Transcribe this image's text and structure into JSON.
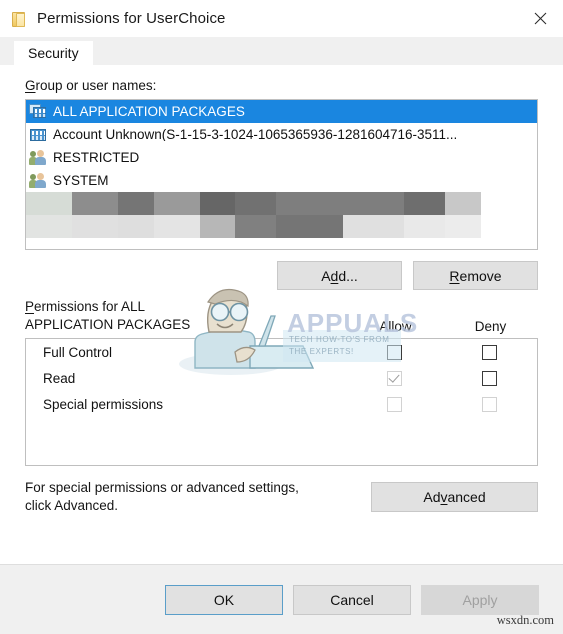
{
  "window": {
    "title": "Permissions for UserChoice",
    "icon": "folder-icon",
    "close_label": "×"
  },
  "tabs": [
    {
      "label": "Security",
      "active": true
    }
  ],
  "group_section": {
    "label": "Group or user names:",
    "label_accel": "G",
    "label_rest": "roup or user names:",
    "items": [
      {
        "name": "ALL APPLICATION PACKAGES",
        "icon": "app-package-icon",
        "selected": true
      },
      {
        "name": "Account Unknown(S-1-15-3-1024-1065365936-1281604716-3511...",
        "icon": "app-package-icon",
        "selected": false
      },
      {
        "name": "RESTRICTED",
        "icon": "user-group-icon",
        "selected": false
      },
      {
        "name": "SYSTEM",
        "icon": "user-group-icon",
        "selected": false
      }
    ],
    "censored_rows": [
      [
        "#d6dcd6",
        "#8d8d8d",
        "#757575",
        "#9a9a9a",
        "#666666",
        "#717171",
        "#7e7e7e",
        "#7e7e7e",
        "#6e6e6e",
        "#c8c8c8",
        "#ffffff"
      ],
      [
        "#e2e4e2",
        "#e0e0e0",
        "#dedede",
        "#e4e4e4",
        "#b7b7b7",
        "#808080",
        "#757575",
        "#e0e0e0",
        "#e9e9e9",
        "#ececec",
        "#ffffff"
      ]
    ]
  },
  "buttons": {
    "add": "Add...",
    "add_accel": "d",
    "remove": "Remove",
    "remove_accel": "R",
    "advanced": "Advanced",
    "advanced_accel": "v",
    "ok": "OK",
    "cancel": "Cancel",
    "apply": "Apply"
  },
  "permissions_section": {
    "label_line1": "Permissions for ALL",
    "label_line2": "APPLICATION PACKAGES",
    "label_accel": "P",
    "columns": [
      "Allow",
      "Deny"
    ],
    "rows": [
      {
        "name": "Full Control",
        "allow": "unchecked",
        "deny": "unchecked"
      },
      {
        "name": "Read",
        "allow": "checked-disabled",
        "deny": "unchecked"
      },
      {
        "name": "Special permissions",
        "allow": "unchecked-disabled",
        "deny": "unchecked-disabled"
      }
    ]
  },
  "advanced_note": {
    "line1": "For special permissions or advanced settings,",
    "line2": "click Advanced."
  },
  "watermarks": {
    "appuals": "APPUALS",
    "appuals_sub1": "TECH HOW-TO'S FROM",
    "appuals_sub2": "THE EXPERTS!",
    "site": "wsxdn.com"
  },
  "colors": {
    "selection": "#1a86e0",
    "dialog_bg": "#ffffff",
    "footer_bg": "#f0f0f0",
    "button_face": "#e1e1e1",
    "focus_border": "#5a9ec9"
  }
}
